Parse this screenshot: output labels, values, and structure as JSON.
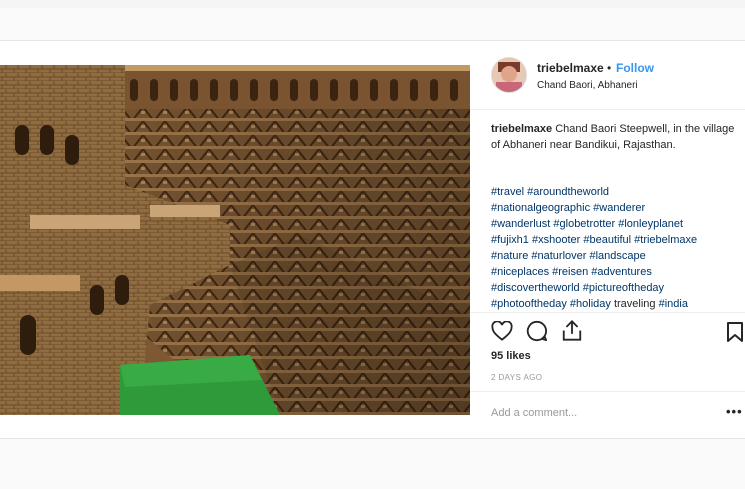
{
  "post": {
    "username": "triebelmaxe",
    "separator": "•",
    "follow_label": "Follow",
    "location": "Chand Baori, Abhaneri",
    "caption_user": "triebelmaxe",
    "caption_text": " Chand Baori Steepwell, in the village of Abhaneri near Bandikui, Rajasthan.",
    "tag_lines": [
      [
        {
          "t": "#travel",
          "tag": true
        },
        {
          "t": " ",
          "tag": false
        },
        {
          "t": "#aroundtheworld",
          "tag": true
        }
      ],
      [
        {
          "t": "#nationalgeographic",
          "tag": true
        },
        {
          "t": " ",
          "tag": false
        },
        {
          "t": "#wanderer",
          "tag": true
        }
      ],
      [
        {
          "t": "#wanderlust",
          "tag": true
        },
        {
          "t": " ",
          "tag": false
        },
        {
          "t": "#globetrotter",
          "tag": true
        },
        {
          "t": " ",
          "tag": false
        },
        {
          "t": "#lonleyplanet",
          "tag": true
        }
      ],
      [
        {
          "t": "#fujixh1",
          "tag": true
        },
        {
          "t": " ",
          "tag": false
        },
        {
          "t": "#xshooter",
          "tag": true
        },
        {
          "t": " ",
          "tag": false
        },
        {
          "t": "#beautiful",
          "tag": true
        },
        {
          "t": " ",
          "tag": false
        },
        {
          "t": "#triebelmaxe",
          "tag": true
        }
      ],
      [
        {
          "t": "#nature",
          "tag": true
        },
        {
          "t": " ",
          "tag": false
        },
        {
          "t": "#naturlover",
          "tag": true
        },
        {
          "t": " ",
          "tag": false
        },
        {
          "t": "#landscape",
          "tag": true
        }
      ],
      [
        {
          "t": "#niceplaces",
          "tag": true
        },
        {
          "t": " ",
          "tag": false
        },
        {
          "t": "#reisen",
          "tag": true
        },
        {
          "t": " ",
          "tag": false
        },
        {
          "t": "#adventures",
          "tag": true
        }
      ],
      [
        {
          "t": "#discovertheworld",
          "tag": true
        },
        {
          "t": " ",
          "tag": false
        },
        {
          "t": "#pictureoftheday",
          "tag": true
        }
      ],
      [
        {
          "t": "#photooftheday",
          "tag": true
        },
        {
          "t": " ",
          "tag": false
        },
        {
          "t": "#holiday",
          "tag": true
        },
        {
          "t": " traveling ",
          "tag": false
        },
        {
          "t": "#india",
          "tag": true
        }
      ]
    ],
    "likes": "95 likes",
    "time_ago": "2 DAYS AGO",
    "comment_placeholder": "Add a comment...",
    "more_label": "•••",
    "icons": {
      "like": "heart-icon",
      "comment": "comment-bubble-icon",
      "share": "share-icon",
      "save": "bookmark-icon"
    }
  },
  "colors": {
    "link": "#003569",
    "follow": "#3897f0",
    "muted": "#999999",
    "pool_green": "#2f9a3a",
    "stone": "#9c7448"
  }
}
